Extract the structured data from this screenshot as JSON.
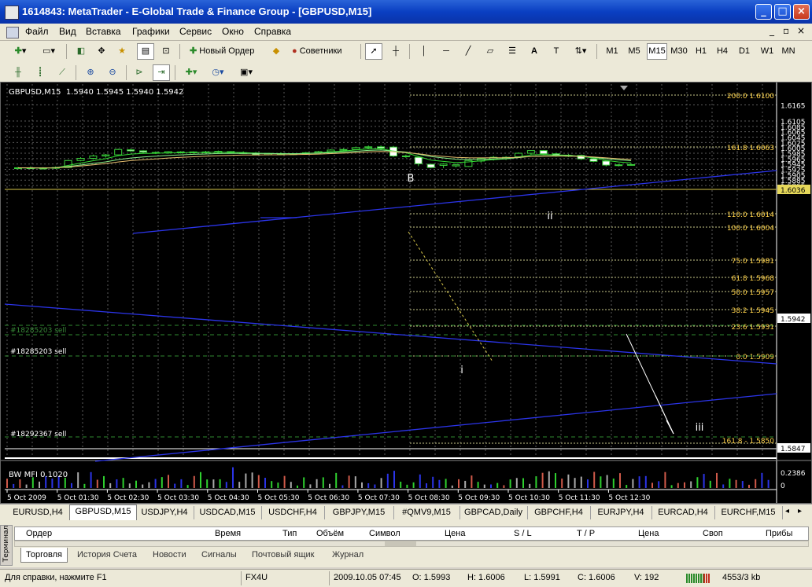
{
  "window": {
    "title": "1614843: MetaTrader - E-Global Trade & Finance Group - [GBPUSD,M15]"
  },
  "menu": [
    "Файл",
    "Вид",
    "Вставка",
    "Графики",
    "Сервис",
    "Окно",
    "Справка"
  ],
  "toolbar": {
    "new_order": "Новый Ордер",
    "experts": "Советники",
    "timeframes": [
      "M1",
      "M5",
      "M15",
      "M30",
      "H1",
      "H4",
      "D1",
      "W1",
      "MN"
    ],
    "active_timeframe": "M15"
  },
  "chart": {
    "symbol_info": "GBPUSD,M15  1.5940 1.5945 1.5940 1.5942",
    "price_levels": [
      "1.6165",
      "1.6105",
      "1.6085",
      "1.6065",
      "1.6045",
      "1.6025",
      "1.6005",
      "1.5985",
      "1.5965",
      "1.5945",
      "1.5925",
      "1.5905",
      "1.5885",
      "1.5865"
    ],
    "current_price_label": "1.5942",
    "horizontal_line_label": "1.6036",
    "bottom_price_label": "1.5847",
    "fibo_labels": [
      "200.0 1.6100",
      "161.8 1.6063",
      "110.0 1.6014",
      "100.0 1.6004",
      "75.0 1.5981",
      "61.8 1.5968",
      "50.0 1.5957",
      "38.2 1.5945",
      "23.6 1.5931",
      "0.0 1.5909",
      "161.8 - 1.5850"
    ],
    "wave_labels": [
      "B",
      "ii",
      "i",
      "iii"
    ],
    "order_labels": [
      "#18285203 sell",
      "#18292367 sell"
    ],
    "order_label_faint": "#18285203 sell",
    "indicator_label": "BW MFI 0.1020",
    "indicator_scale": [
      "0.2386",
      "0"
    ],
    "time_labels": [
      "5 Oct 2009",
      "5 Oct 01:30",
      "5 Oct 02:30",
      "5 Oct 03:30",
      "5 Oct 04:30",
      "5 Oct 05:30",
      "5 Oct 06:30",
      "5 Oct 07:30",
      "5 Oct 08:30",
      "5 Oct 09:30",
      "5 Oct 10:30",
      "5 Oct 11:30",
      "5 Oct 12:30"
    ]
  },
  "symbol_tabs": [
    "EURUSD,H4",
    "GBPUSD,M15",
    "USDJPY,H4",
    "USDCAD,M15",
    "USDCHF,H4",
    "GBPJPY,M15",
    "#QMV9,M15",
    "GBPCAD,Daily",
    "GBPCHF,H4",
    "EURJPY,H4",
    "EURCAD,H4",
    "EURCHF,M15"
  ],
  "active_symbol_tab": "GBPUSD,M15",
  "terminal": {
    "side_label": "Терминал",
    "columns": [
      "Ордер",
      "Время",
      "Тип",
      "Объём",
      "Символ",
      "Цена",
      "S / L",
      "T / P",
      "Цена",
      "Своп",
      "Прибы"
    ],
    "tabs": [
      "Торговля",
      "История Счета",
      "Новости",
      "Сигналы",
      "Почтовый ящик",
      "Журнал"
    ]
  },
  "status": {
    "help": "Для справки, нажмите F1",
    "profile": "FX4U",
    "datetime": "2009.10.05 07:45",
    "open": "O: 1.5993",
    "high": "H: 1.6006",
    "low": "L: 1.5991",
    "close": "C: 1.6006",
    "volume": "V: 192",
    "traffic": "4553/3 kb"
  }
}
